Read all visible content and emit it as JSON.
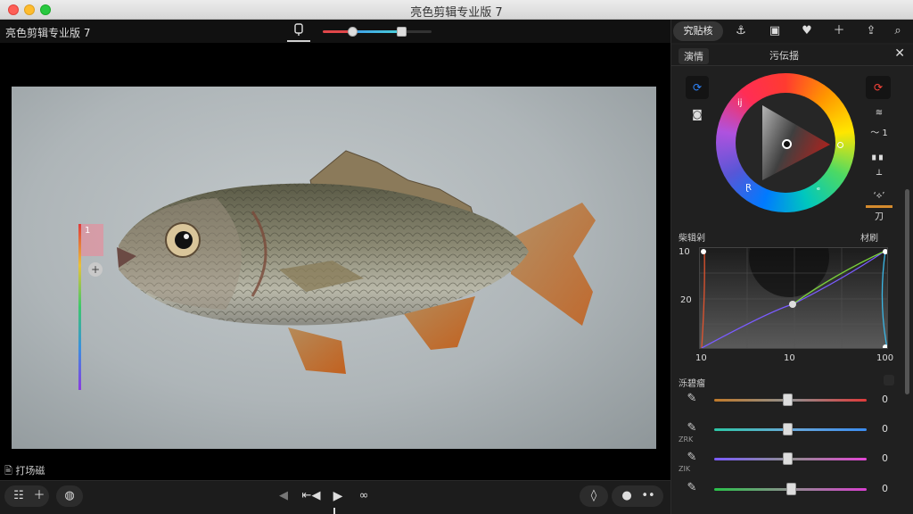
{
  "window": {
    "title": "亮色剪辑专业版 7"
  },
  "toolbar": {
    "app_title": "亮色剪辑专业版 7",
    "clip_icon": "clip-icon",
    "range_slider": {
      "low": 0.2,
      "high": 0.7
    }
  },
  "viewer": {
    "caption": "🖹 打场磁",
    "side_gradient_label": "1",
    "side_gradient_marker": "+"
  },
  "bottombar": {
    "icons": [
      "list-icon",
      "add-icon",
      "tag-icon",
      "prev-icon",
      "step-back-icon",
      "play-icon",
      "loop-icon",
      "drop-icon",
      "user-icon",
      "more-icon"
    ]
  },
  "panel": {
    "header_pill": "究贴核",
    "header_icons": [
      "anchor-icon",
      "frame-icon",
      "heart-icon",
      "add-icon",
      "export-icon",
      "search-icon"
    ],
    "tabs": [
      {
        "label": "演情"
      },
      {
        "label": "污伝揺"
      }
    ],
    "colorwheel_left_buttons": [
      "color-sync-icon",
      "camera-icon"
    ],
    "colorwheel_right_buttons": [
      "color-sync-icon",
      "ratio-icon",
      "curve-icon",
      "histogram-icon",
      "minus-icon",
      "wave-icon",
      "stack-icon"
    ],
    "right_labels": {
      "ratio": "≋",
      "curve": "〜 1",
      "histo": "▖▖",
      "wave": "‘⟡’",
      "stack": "刀"
    },
    "wheel_labels": {
      "left_top": "ij",
      "left_bottom": "Ɽ",
      "right_bottom": "ₑ"
    },
    "curves": {
      "section_label": "柴辑剁",
      "section_right_label": "材刷",
      "y_labels": [
        "10",
        "20"
      ],
      "x_labels": [
        "10",
        "10",
        "100"
      ]
    },
    "sliders": {
      "section_label": "泺碧瘤",
      "items": [
        {
          "icon": "eyedropper-icon",
          "sublabel": "",
          "value": "0",
          "level": 0.48,
          "colors": [
            "#c07a2a",
            "#8f8f8f",
            "#e03a3a"
          ]
        },
        {
          "icon": "eyedropper-icon",
          "sublabel": "ZRK",
          "value": "0",
          "level": 0.48,
          "colors": [
            "#2dc6a6",
            "#6aa8d8",
            "#3b8cf0"
          ]
        },
        {
          "icon": "eyedropper-icon",
          "sublabel": "ZIK",
          "value": "0",
          "level": 0.48,
          "colors": [
            "#7b5cff",
            "#8f8f8f",
            "#e445d6"
          ]
        },
        {
          "icon": "eyedropper-icon",
          "sublabel": "",
          "value": "0",
          "level": 0.5,
          "colors": [
            "#29c14a",
            "#8f8f8f",
            "#d93fd0"
          ]
        }
      ]
    }
  },
  "colors": {
    "accent_blue": "#2f86ff",
    "accent_red": "#ff453a",
    "panel_bg": "#202020",
    "toolbar_bg": "#111111"
  }
}
